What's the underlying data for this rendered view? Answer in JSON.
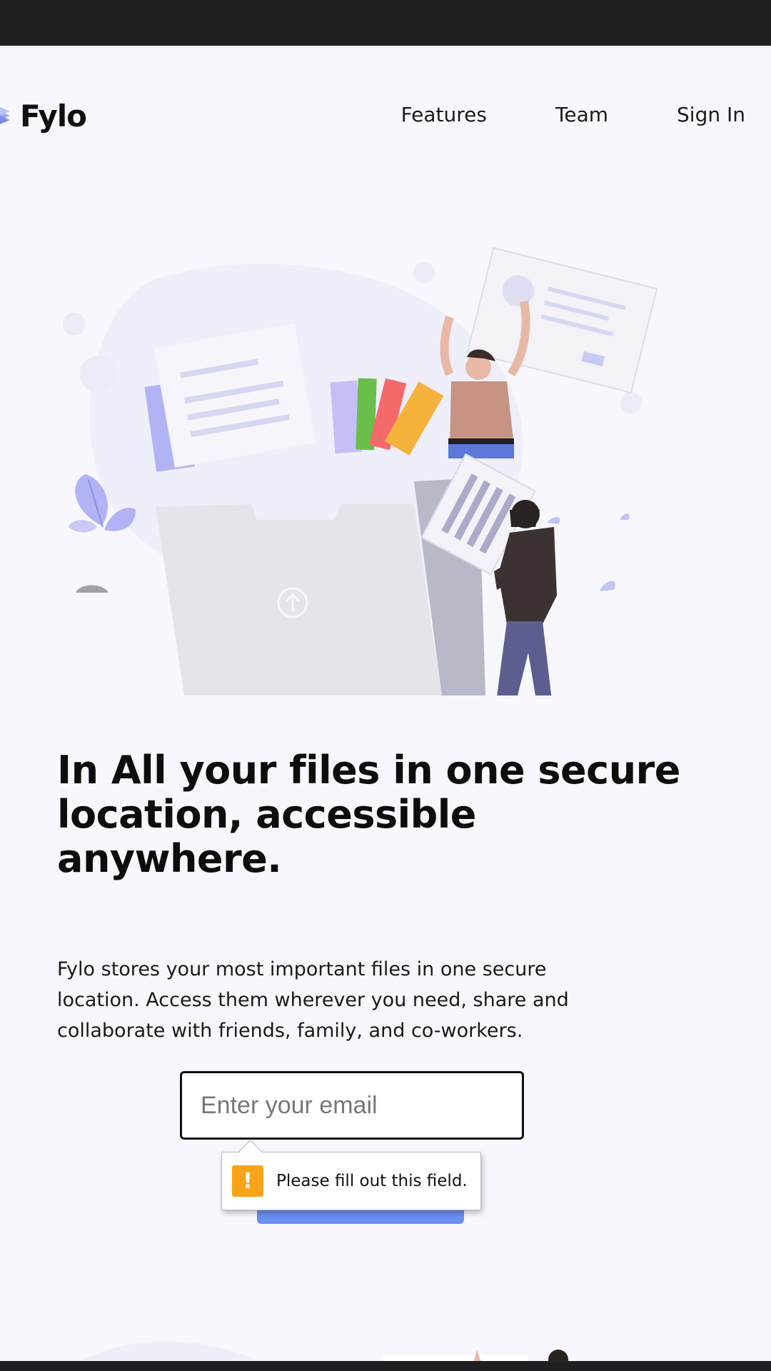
{
  "brand": {
    "name": "Fylo"
  },
  "nav": {
    "features": "Features",
    "team": "Team",
    "sign_in": "Sign In"
  },
  "hero": {
    "headline": "In All your files in one secure location, accessible anywhere.",
    "description": "Fylo stores your most important files in one secure location. Access them wherever you need, share and collaborate with friends, family, and co-workers."
  },
  "signup": {
    "email_placeholder": "Enter your email",
    "email_value": "",
    "submit_label": ""
  },
  "validation": {
    "message": "Please fill out this field.",
    "icon": "warning-icon"
  },
  "colors": {
    "page_bg": "#f7f7fd",
    "frame_bg": "#1f1f24",
    "accent_blue": "#6b8ef2",
    "warning_orange": "#f7a41a"
  }
}
